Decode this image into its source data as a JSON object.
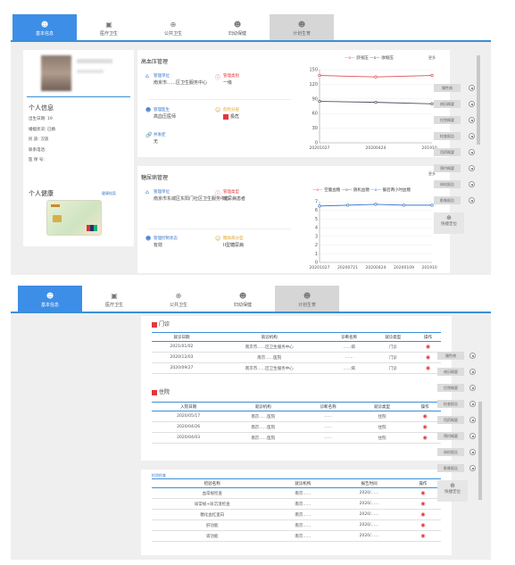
{
  "tabs": [
    {
      "label": "基本信息",
      "icon": "person-icon"
    },
    {
      "label": "医疗卫生",
      "icon": "medkit-icon"
    },
    {
      "label": "公共卫生",
      "icon": "globe-icon"
    },
    {
      "label": "妇幼保健",
      "icon": "mother-icon"
    },
    {
      "label": "计划生育",
      "icon": "family-icon"
    }
  ],
  "profile": {
    "info_title": "个人信息",
    "fields": [
      {
        "label": "出生日期:",
        "value": "19"
      },
      {
        "label": "婚姻状况:",
        "value": "已婚"
      },
      {
        "label": "民    族:",
        "value": "汉族"
      },
      {
        "label": "联系电话:",
        "value": ""
      },
      {
        "label": "医 保 号:",
        "value": ""
      }
    ],
    "health_title": "个人健康",
    "card_link": "健康档案"
  },
  "hypertension": {
    "title": "高血压管理",
    "more": "更多",
    "unit_label": "管理单位",
    "unit_value": "南京市……区卫生服务中心",
    "type_label": "管理类别",
    "type_value": "一级",
    "doctor_label": "管理医生",
    "doctor_value": "高血压医师",
    "risk_label": "危险分层",
    "risk_value": "极危",
    "comp_label": "并发症",
    "comp_value": "无",
    "legend": [
      "舒张压",
      "收缩压"
    ],
    "colors": {
      "diastolic": "#e05050",
      "systolic": "#4a5060"
    }
  },
  "diabetes": {
    "title": "糖尿病管理",
    "more": "更多",
    "unit_label": "管理单位",
    "unit_value": "南京市东城区东阳门社区卫生服务中心",
    "type_label": "管理类型",
    "type_value": "糖尿病患者",
    "status_label": "管理控制状态",
    "status_value": "有效",
    "level_label": "糖尿病分型",
    "level_value": "II型糖尿病",
    "legend": [
      "空腹血糖",
      "随机血糖",
      "餐后两小时血糖"
    ]
  },
  "chart_data": [
    {
      "type": "line",
      "x": [
        "20201027",
        "20200424",
        "20191018"
      ],
      "series": [
        {
          "name": "舒张压",
          "values": [
            138,
            135,
            138
          ]
        },
        {
          "name": "收缩压",
          "values": [
            85,
            83,
            80
          ]
        }
      ],
      "ylim": [
        0,
        150
      ],
      "yticks": [
        0,
        30,
        60,
        90,
        120,
        150
      ]
    },
    {
      "type": "line",
      "x": [
        "20201027",
        "20200721",
        "20200424",
        "20200109",
        "20191018"
      ],
      "series": [
        {
          "name": "空腹血糖",
          "values": [
            6.5,
            6.6,
            6.7,
            6.6,
            6.6
          ]
        }
      ],
      "ylim": [
        0,
        7
      ],
      "yticks": [
        0,
        1,
        2,
        3,
        4,
        5,
        6,
        7
      ]
    }
  ],
  "side_buttons": [
    "慢性病",
    "病历概要",
    "住院概要",
    "检查报告",
    "用药概要",
    "预约概要",
    "体检报告",
    "影像报告"
  ],
  "quick_label": "快捷定位",
  "outpatient": {
    "title": "门诊",
    "headers": [
      "就诊日期",
      "就诊机构",
      "诊断名称",
      "就诊类型",
      "操作"
    ],
    "rows": [
      [
        "2021/01/02",
        "南京市……区卫生服务中心",
        "……病",
        "门诊"
      ],
      [
        "2020/12/03",
        "南京……医院",
        "……",
        "门诊"
      ],
      [
        "2020/09/27",
        "南京市……区卫生服务中心",
        "……病",
        "门诊"
      ]
    ]
  },
  "inpatient": {
    "title": "住院",
    "headers": [
      "入院日期",
      "就诊机构",
      "诊断名称",
      "就诊类型",
      "操作"
    ],
    "rows": [
      [
        "2020/05/17",
        "南京……医院",
        "……",
        "住院"
      ],
      [
        "2020/04/26",
        "南京……医院",
        "……",
        "住院"
      ],
      [
        "2020/04/03",
        "南京……医院",
        "……",
        "住院"
      ]
    ]
  },
  "checkup": {
    "title": "检验检查",
    "headers": [
      "检验名称",
      "就诊机构",
      "报告时间",
      "操作"
    ],
    "rows": [
      [
        "血常规检查",
        "南京……",
        "2020/……"
      ],
      [
        "尿常规+尿沉渣检查",
        "南京……",
        "2020/……"
      ],
      [
        "糖化血红蛋白",
        "南京……",
        "2020/……"
      ],
      [
        "肝功能",
        "南京……",
        "2020/……"
      ],
      [
        "肾功能",
        "南京……",
        "2020/……"
      ]
    ]
  }
}
